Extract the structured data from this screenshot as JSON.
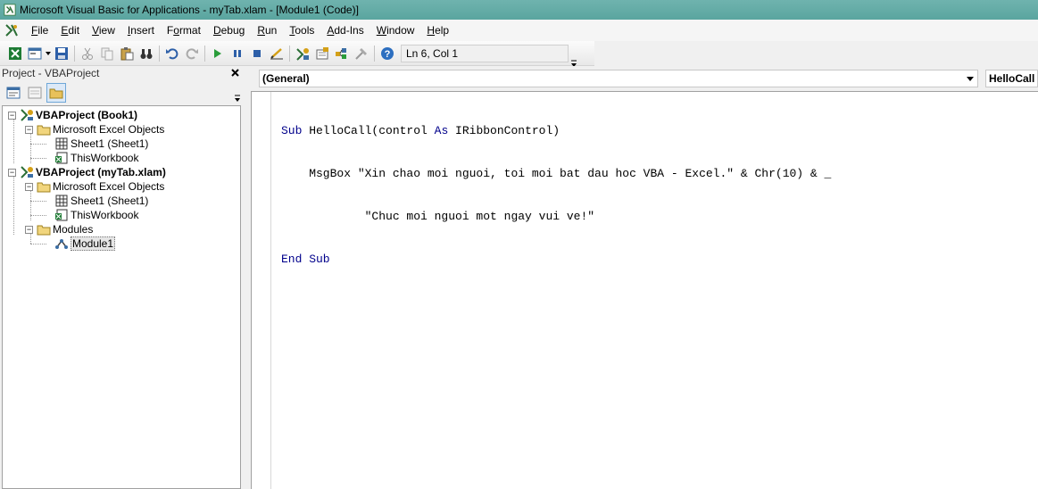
{
  "window": {
    "title": "Microsoft Visual Basic for Applications - myTab.xlam - [Module1 (Code)]"
  },
  "menu": [
    {
      "label": "File",
      "u": "F",
      "rest": "ile"
    },
    {
      "label": "Edit",
      "u": "E",
      "rest": "dit"
    },
    {
      "label": "View",
      "u": "V",
      "rest": "iew"
    },
    {
      "label": "Insert",
      "u": "I",
      "rest": "nsert"
    },
    {
      "label": "Format",
      "u": "o",
      "pre": "F",
      "rest": "rmat"
    },
    {
      "label": "Debug",
      "u": "D",
      "rest": "ebug"
    },
    {
      "label": "Run",
      "u": "R",
      "rest": "un"
    },
    {
      "label": "Tools",
      "u": "T",
      "rest": "ools"
    },
    {
      "label": "Add-Ins",
      "u": "A",
      "rest": "dd-Ins"
    },
    {
      "label": "Window",
      "u": "W",
      "rest": "indow"
    },
    {
      "label": "Help",
      "u": "H",
      "rest": "elp"
    }
  ],
  "toolbar": {
    "position_text": "Ln 6, Col 1"
  },
  "project_pane": {
    "title": "Project - VBAProject",
    "close_label": "✕",
    "tree": [
      {
        "label": "VBAProject (Book1)",
        "bold": true
      },
      {
        "label": "Microsoft Excel Objects"
      },
      {
        "label": "Sheet1 (Sheet1)"
      },
      {
        "label": "ThisWorkbook"
      },
      {
        "label": "VBAProject (myTab.xlam)",
        "bold": true
      },
      {
        "label": "Microsoft Excel Objects"
      },
      {
        "label": "Sheet1 (Sheet1)"
      },
      {
        "label": "ThisWorkbook"
      },
      {
        "label": "Modules"
      },
      {
        "label": "Module1",
        "selected": true
      }
    ]
  },
  "code_window": {
    "object_combo": "(General)",
    "procedure_combo": "HelloCall",
    "lines": [
      {
        "kw1": "Sub",
        "text": " HelloCall(control ",
        "kw2": "As",
        "text2": " IRibbonControl)"
      },
      {
        "text": "    MsgBox \"Xin chao moi nguoi, toi moi bat dau hoc VBA - Excel.\" & Chr(10) & _"
      },
      {
        "text": "            \"Chuc moi nguoi mot ngay vui ve!\""
      },
      {
        "kw1": "End Sub",
        "text": ""
      }
    ]
  },
  "colors": {
    "titlebar": "#5aa59f",
    "keyword": "#00008b"
  }
}
